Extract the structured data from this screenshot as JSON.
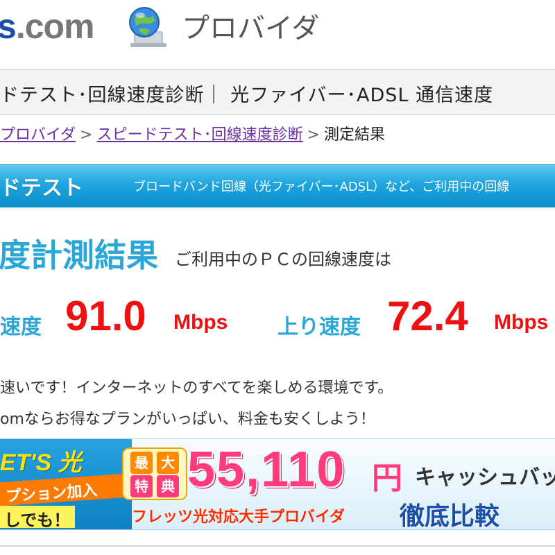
{
  "header": {
    "logo_prefix": "",
    "logo_highlight": "s",
    "logo_suffix": ".com",
    "provider_label": "プロバイダ"
  },
  "title_bar": {
    "text": "ドテスト･回線速度診断｜ 光ファイバー･ADSL 通信速度"
  },
  "breadcrumb": {
    "items": [
      {
        "label": "プロバイダ"
      },
      {
        "label": "スピードテスト･回線速度診断"
      }
    ],
    "separator": ">",
    "current": "測定結果"
  },
  "section": {
    "title": "ドテスト",
    "description": "ブロードバンド回線（光ファイバー･ADSL）など、ご利用中の回線"
  },
  "result": {
    "heading": "度計測結果",
    "subheading": "ご利用中のＰＣの回線速度は",
    "download": {
      "label": "速度",
      "value": "91.0",
      "unit": "Mbps"
    },
    "upload": {
      "label": "上り速度",
      "value": "72.4",
      "unit": "Mbps"
    }
  },
  "messages": [
    "速いです！インターネットのすべてを楽しめる環境です。",
    "omならお得なプランがいっぱい、料金も安くしよう！"
  ],
  "banner": {
    "brand": "ET'S 光",
    "ribbon_text": "プション加入",
    "sub_text": "しでも！",
    "badge_chars": [
      "最",
      "大",
      "特",
      "典"
    ],
    "amount": "55,110",
    "yen": "円",
    "cashback": "キャッシュバッ",
    "footer_text": "フレッツ光対応大手プロバイダ",
    "compare": "徹底比較"
  },
  "colors": {
    "accent_blue": "#2aa7d8",
    "speed_red": "#ee1111",
    "link_purple": "#6b2fa3",
    "banner_pink": "#ff3b7e"
  }
}
